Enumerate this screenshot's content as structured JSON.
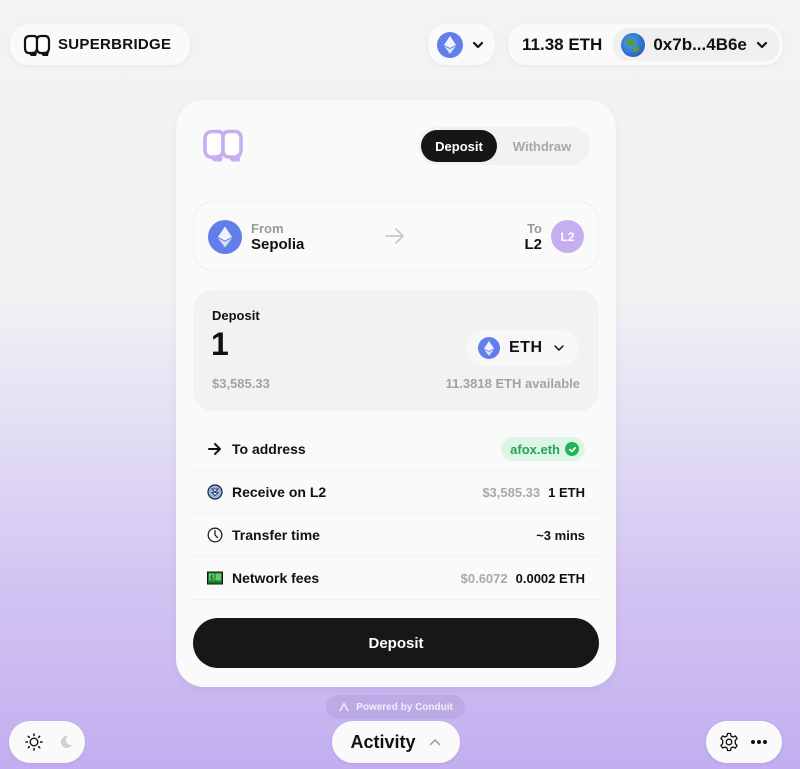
{
  "header": {
    "brand": "SUPERBRIDGE",
    "chain_selector": {
      "network_icon": "ethereum-icon"
    },
    "wallet": {
      "balance": "11.38 ETH",
      "address": "0x7b...4B6e",
      "avatar_icon": "globe-icon"
    }
  },
  "bridge": {
    "tabs": [
      {
        "label": "Deposit",
        "active": true
      },
      {
        "label": "Withdraw",
        "active": false
      }
    ],
    "route": {
      "from_label": "From",
      "from_network": "Sepolia",
      "to_label": "To",
      "to_network": "L2",
      "to_badge": "L2"
    },
    "amount": {
      "label": "Deposit",
      "value": "1",
      "usd_value": "$3,585.33",
      "token": "ETH",
      "available": "11.3818 ETH available"
    },
    "details": [
      {
        "icon": "arrow-right-icon",
        "label": "To address",
        "badge": "afox.eth",
        "verified": true
      },
      {
        "icon": "receive-icon",
        "label": "Receive on L2",
        "sub": "$3,585.33",
        "value": "1 ETH"
      },
      {
        "icon": "clock-icon",
        "label": "Transfer time",
        "value": "~3 mins"
      },
      {
        "icon": "money-icon",
        "label": "Network fees",
        "sub": "$0.6072",
        "value": "0.0002 ETH"
      }
    ],
    "submit_label": "Deposit"
  },
  "footer": {
    "powered_by": "Powered by Conduit",
    "activity_label": "Activity"
  },
  "colors": {
    "accent_purple": "#c6aff0",
    "eth_blue": "#627eea",
    "verified_green": "#22b45a",
    "button_dark": "#171717"
  }
}
